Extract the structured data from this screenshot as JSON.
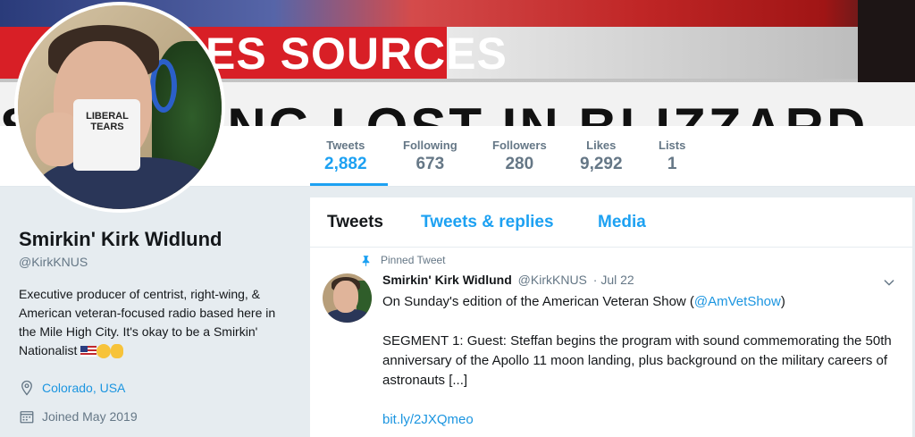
{
  "banner": {
    "headline": "ES SOURCES",
    "ticker": "S GETTING LOST IN BLIZZARD"
  },
  "avatar": {
    "mug_text": "LIBERAL TEARS"
  },
  "stats": [
    {
      "label": "Tweets",
      "value": "2,882"
    },
    {
      "label": "Following",
      "value": "673"
    },
    {
      "label": "Followers",
      "value": "280"
    },
    {
      "label": "Likes",
      "value": "9,292"
    },
    {
      "label": "Lists",
      "value": "1"
    }
  ],
  "profile": {
    "name": "Smirkin' Kirk Widlund",
    "handle": "@KirkKNUS",
    "bio": "Executive producer of centrist, right-wing, & American veteran-focused radio based here in the Mile High City. It's okay to be a Smirkin' Nationalist",
    "location": "Colorado, USA",
    "joined": "Joined May 2019"
  },
  "tabs": {
    "tweets": "Tweets",
    "replies": "Tweets & replies",
    "media": "Media"
  },
  "tweet": {
    "pinned_label": "Pinned Tweet",
    "author_name": "Smirkin' Kirk Widlund",
    "author_handle": "@KirkKNUS",
    "date": "· Jul 22",
    "line1_pre": "On Sunday's edition of the American Veteran Show (",
    "line1_mention": "@AmVetShow",
    "line1_post": ")",
    "body": "SEGMENT 1: Guest: Steffan begins the program with sound commemorating the 50th anniversary of the Apollo 11 moon landing, plus background on the military careers of astronauts [...]",
    "link": "bit.ly/2JXQmeo"
  }
}
